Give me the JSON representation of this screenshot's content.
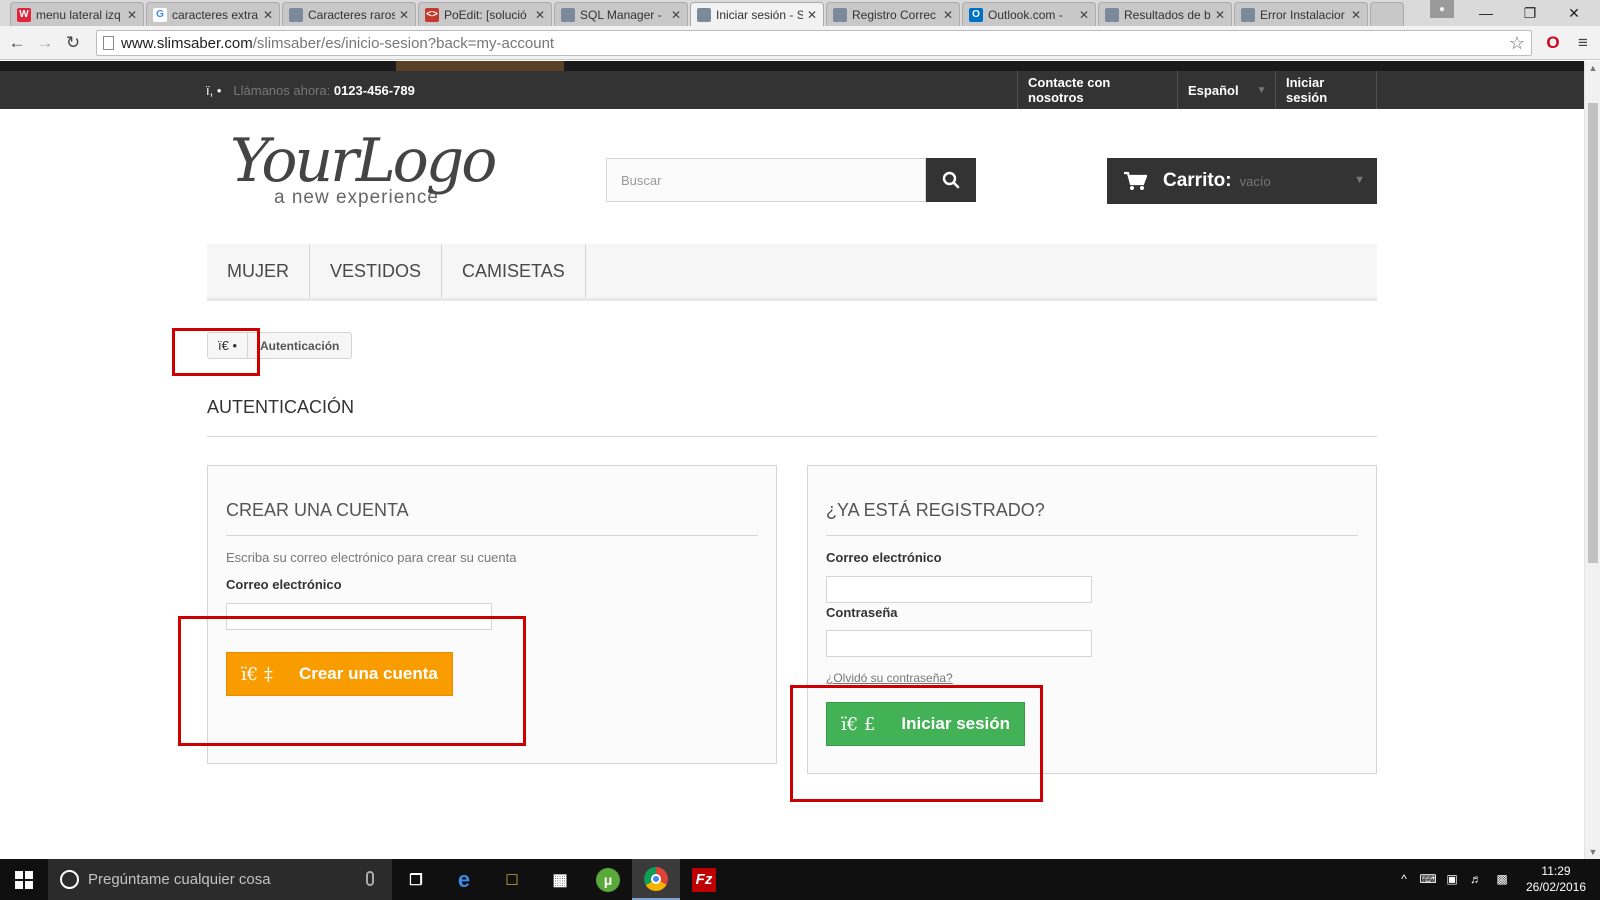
{
  "browser": {
    "tabs": [
      {
        "label": "menu lateral izq",
        "icon": "wuolah-icon",
        "fav_color": "#e0243c",
        "fav_text": "W"
      },
      {
        "label": "caracteres extra",
        "icon": "google-icon",
        "fav_color": "#ffffff",
        "fav_text": "G"
      },
      {
        "label": "Caracteres raros",
        "icon": "site-icon",
        "fav_color": "#7b8a9a",
        "fav_text": ""
      },
      {
        "label": "PoEdit: [solució",
        "icon": "code-icon",
        "fav_color": "#c0392b",
        "fav_text": "<>"
      },
      {
        "label": "SQL Manager -",
        "icon": "site-icon",
        "fav_color": "#7b8a9a",
        "fav_text": ""
      },
      {
        "label": "Iniciar sesión - S",
        "icon": "site-icon",
        "fav_color": "#7b8a9a",
        "fav_text": ""
      },
      {
        "label": "Registro Correc",
        "icon": "site-icon",
        "fav_color": "#7b8a9a",
        "fav_text": ""
      },
      {
        "label": "Outlook.com - ",
        "icon": "outlook-icon",
        "fav_color": "#0072c6",
        "fav_text": "O"
      },
      {
        "label": "Resultados de b",
        "icon": "site-icon",
        "fav_color": "#7b8a9a",
        "fav_text": ""
      },
      {
        "label": "Error Instalacior",
        "icon": "site-icon",
        "fav_color": "#7b8a9a",
        "fav_text": ""
      }
    ],
    "active_tab": 5,
    "url_host": "www.slimsaber.com",
    "url_path": "/slimsaber/es/inicio-sesion?back=my-account"
  },
  "header": {
    "phone_glyph": "ï, •",
    "phone_label": "Llámanos ahora: ",
    "phone_number": "0123-456-789",
    "contact": "Contacte con nosotros",
    "language": "Español",
    "login": "Iniciar sesión"
  },
  "logo": {
    "script": "YourLogo",
    "tagline": "a new experience"
  },
  "search": {
    "placeholder": "Buscar"
  },
  "cart": {
    "label": "Carrito:",
    "status": "vacío"
  },
  "menu": {
    "items": [
      "MUJER",
      "VESTIDOS",
      "CAMISETAS"
    ]
  },
  "breadcrumb": {
    "home": "ï€ •",
    "current": "Autenticación"
  },
  "page_title": "AUTENTICACIÓN",
  "create_account": {
    "heading": "CREAR UNA CUENTA",
    "help": "Escriba su correo electrónico para crear su cuenta",
    "email_label": "Correo electrónico",
    "button_glyph": "ï€ ‡",
    "button_label": "Crear una cuenta"
  },
  "login_form": {
    "heading": "¿YA ESTÁ REGISTRADO?",
    "email_label": "Correo electrónico",
    "password_label": "Contraseña",
    "forgot": "¿Olvidó su contraseña?",
    "button_glyph": "ï€ £",
    "button_label": "Iniciar sesión"
  },
  "taskbar": {
    "search_placeholder": "Pregúntame cualquier cosa",
    "time": "11:29",
    "date": "26/02/2016"
  },
  "colors": {
    "accent_orange": "#f89c00",
    "accent_green": "#43b155",
    "highlight_red": "#cc0000",
    "dark_bar": "#333333"
  }
}
